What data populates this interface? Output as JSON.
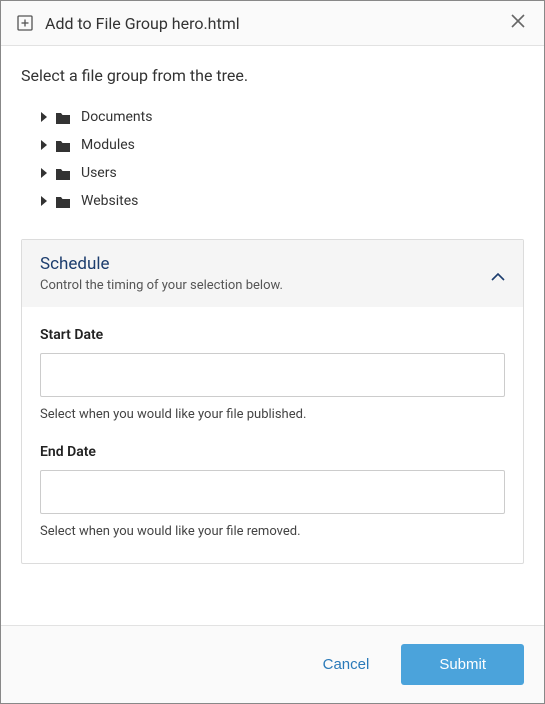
{
  "header": {
    "title": "Add to File Group hero.html"
  },
  "body": {
    "instruction": "Select a file group from the tree.",
    "tree": {
      "items": [
        {
          "label": "Documents"
        },
        {
          "label": "Modules"
        },
        {
          "label": "Users"
        },
        {
          "label": "Websites"
        }
      ]
    },
    "schedule": {
      "title": "Schedule",
      "subtitle": "Control the timing of your selection below.",
      "start": {
        "label": "Start Date",
        "value": "",
        "help": "Select when you would like your file published."
      },
      "end": {
        "label": "End Date",
        "value": "",
        "help": "Select when you would like your file removed."
      }
    }
  },
  "footer": {
    "cancel": "Cancel",
    "submit": "Submit"
  }
}
